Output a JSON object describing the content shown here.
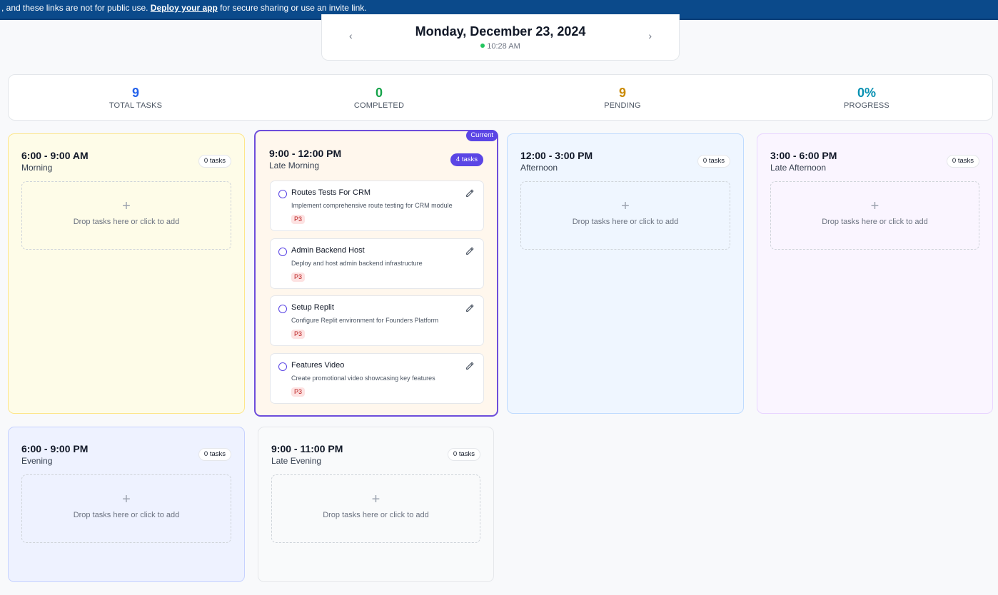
{
  "banner": {
    "text_before": ", and these links are not for public use. ",
    "link_label": "Deploy your app",
    "text_after": " for secure sharing or use an invite link."
  },
  "date_nav": {
    "date": "Monday, December 23, 2024",
    "time": "10:28 AM",
    "prev_icon": "chevron-left",
    "next_icon": "chevron-right"
  },
  "stats": {
    "total": {
      "value": "9",
      "label": "TOTAL TASKS",
      "color": "#2563eb"
    },
    "completed": {
      "value": "0",
      "label": "COMPLETED",
      "color": "#16a34a"
    },
    "pending": {
      "value": "9",
      "label": "PENDING",
      "color": "#ca8a04"
    },
    "progress": {
      "value": "0%",
      "label": "PROGRESS",
      "color": "#0891b2"
    }
  },
  "dropzone": {
    "plus": "+",
    "hint": "Drop tasks here or click to add"
  },
  "blocks": [
    {
      "time": "6:00 - 9:00 AM",
      "name": "Morning",
      "count": "0 tasks",
      "bg": "#fefce8",
      "border": "#fde68a"
    },
    {
      "time": "9:00 - 12:00 PM",
      "name": "Late Morning",
      "count": "4 tasks",
      "bg": "#fff7ed",
      "border": "#6d4ddb",
      "current_label": "Current",
      "tasks": [
        {
          "title": "Routes Tests For CRM",
          "desc": "Implement comprehensive route testing for CRM module",
          "priority": "P3"
        },
        {
          "title": "Admin Backend Host",
          "desc": "Deploy and host admin backend infrastructure",
          "priority": "P3"
        },
        {
          "title": "Setup Replit",
          "desc": "Configure Replit environment for Founders Platform",
          "priority": "P3"
        },
        {
          "title": "Features Video",
          "desc": "Create promotional video showcasing key features",
          "priority": "P3"
        }
      ]
    },
    {
      "time": "12:00 - 3:00 PM",
      "name": "Afternoon",
      "count": "0 tasks",
      "bg": "#eff6ff",
      "border": "#bfdbfe"
    },
    {
      "time": "3:00 - 6:00 PM",
      "name": "Late Afternoon",
      "count": "0 tasks",
      "bg": "#faf5ff",
      "border": "#e9d5ff"
    },
    {
      "time": "6:00 - 9:00 PM",
      "name": "Evening",
      "count": "0 tasks",
      "bg": "#eef2ff",
      "border": "#c7d2fe"
    },
    {
      "time": "9:00 - 11:00 PM",
      "name": "Late Evening",
      "count": "0 tasks",
      "bg": "#f9fafb",
      "border": "#e5e7eb"
    }
  ]
}
